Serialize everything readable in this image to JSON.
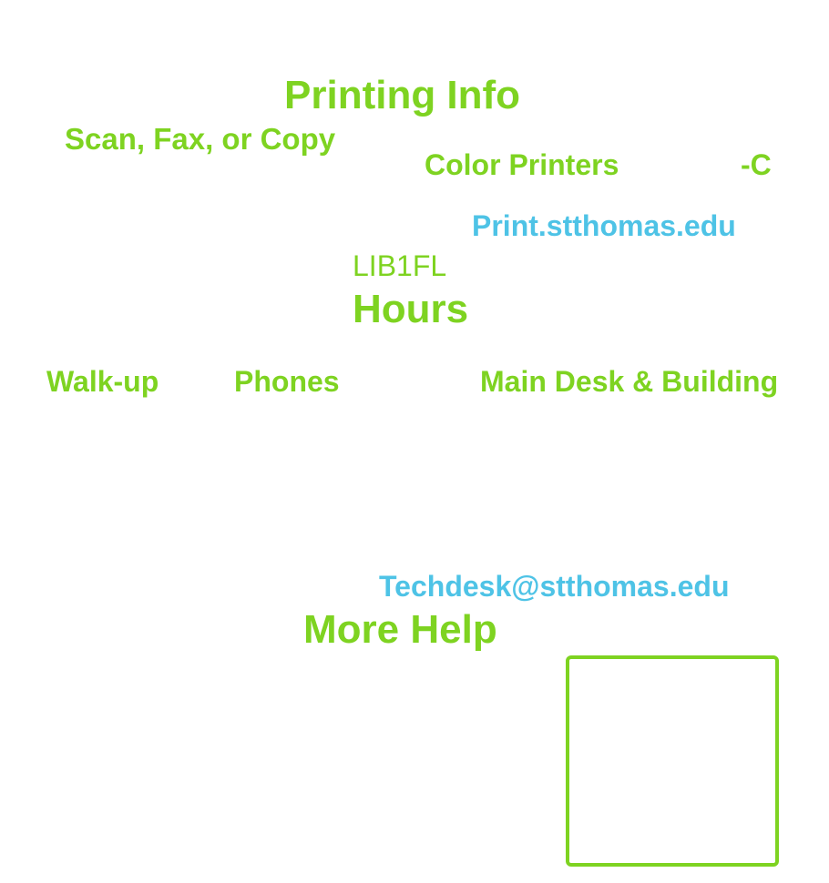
{
  "printing": {
    "title": "Printing Info",
    "scan_fax_copy": "Scan, Fax, or Copy",
    "color_printers": "Color Printers",
    "dash_c": "-C",
    "print_link": "Print.stthomas.edu",
    "printer_name": "LIB1FL"
  },
  "hours": {
    "title": "Hours",
    "walkup": "Walk-up",
    "phones": "Phones",
    "main_desk": "Main Desk & Building"
  },
  "contact": {
    "email": "Techdesk@stthomas.edu"
  },
  "more_help": {
    "title": "More Help"
  },
  "colors": {
    "green": "#7ed321",
    "blue": "#4ec3e6",
    "background": "#ffffff"
  }
}
